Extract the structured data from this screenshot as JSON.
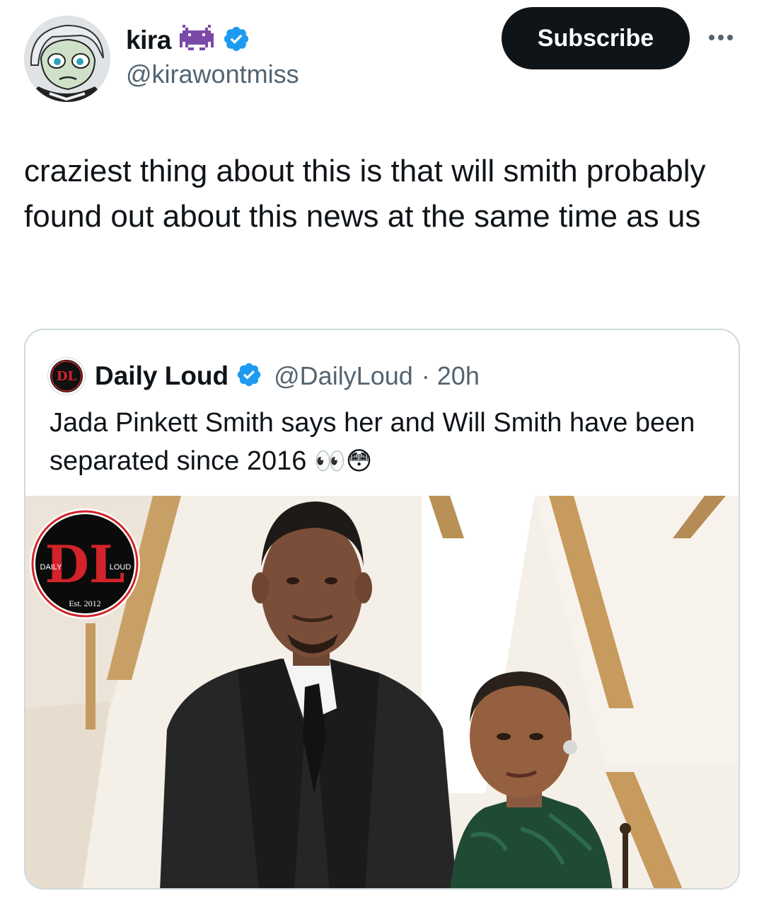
{
  "author": {
    "display_name": "kira",
    "name_emoji_icon": "alien-monster-icon",
    "handle": "@kirawontmiss",
    "verified": true
  },
  "subscribe_label": "Subscribe",
  "more_icon": "more-horizontal-icon",
  "tweet_text": "craziest thing about this is that will smith probably found out about this news at the same time as us",
  "quoted": {
    "display_name": "Daily Loud",
    "verified": true,
    "handle": "@DailyLoud",
    "separator": "·",
    "time": "20h",
    "text": "Jada Pinkett Smith says her and Will Smith have been separated since 2016",
    "emojis": "👀😳",
    "media": {
      "logo_daily": "DAILY",
      "logo_loud": "LOUD",
      "logo_est": "Est. 2012"
    }
  },
  "colors": {
    "text_primary": "#0f1419",
    "text_secondary": "#536471",
    "verified_blue": "#1d9bf0",
    "border": "#cfd9de",
    "logo_red": "#d2232a"
  }
}
